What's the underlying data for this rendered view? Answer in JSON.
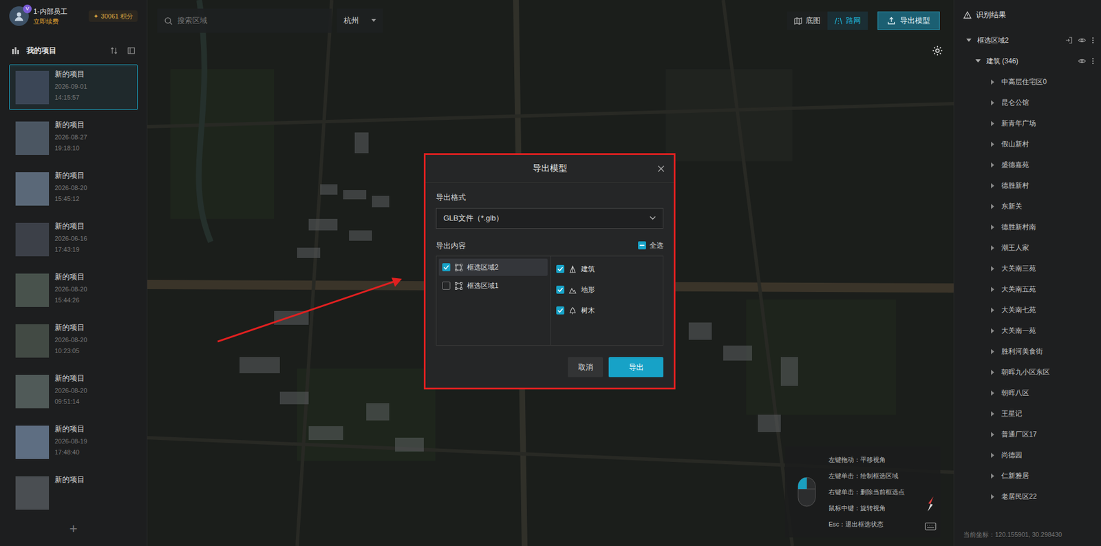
{
  "user": {
    "name": "1-内部员工",
    "badge": "V",
    "points_icon": "✦",
    "points": "30061 积分",
    "renew": "立即续费"
  },
  "projects": {
    "title": "我的项目",
    "add": "+",
    "items": [
      {
        "title": "新的项目",
        "date": "2026-09-01",
        "time": "14:15:57",
        "selected": true
      },
      {
        "title": "新的项目",
        "date": "2026-08-27",
        "time": "19:18:10",
        "selected": false
      },
      {
        "title": "新的项目",
        "date": "2026-08-20",
        "time": "15:45:12",
        "selected": false
      },
      {
        "title": "新的项目",
        "date": "2026-06-16",
        "time": "17:43:19",
        "selected": false
      },
      {
        "title": "新的项目",
        "date": "2026-08-20",
        "time": "15:44:26",
        "selected": false
      },
      {
        "title": "新的项目",
        "date": "2026-08-20",
        "time": "10:23:05",
        "selected": false
      },
      {
        "title": "新的项目",
        "date": "2026-08-20",
        "time": "09:51:14",
        "selected": false
      },
      {
        "title": "新的项目",
        "date": "2026-08-19",
        "time": "17:48:40",
        "selected": false
      },
      {
        "title": "新的项目",
        "selected": false
      }
    ]
  },
  "toolbar": {
    "search": {
      "placeholder": "搜索区域"
    },
    "city": "杭州",
    "view_tabs": [
      {
        "label": "底图",
        "selected": false
      },
      {
        "label": "路网",
        "selected": true
      }
    ],
    "export_button": "导出模型"
  },
  "dialog": {
    "title": "导出模型",
    "format_label": "导出格式",
    "format_value": "GLB文件（*.glb）",
    "content_label": "导出内容",
    "select_all": {
      "label": "全选",
      "checked": false,
      "indeterminate": true
    },
    "regions": [
      {
        "label": "框选区域2",
        "checked": true,
        "selected": true
      },
      {
        "label": "框选区域1",
        "checked": false,
        "selected": false
      }
    ],
    "layers": [
      {
        "label": "建筑",
        "checked": true
      },
      {
        "label": "地形",
        "checked": true
      },
      {
        "label": "树木",
        "checked": true
      }
    ],
    "buttons": [
      {
        "label": "取消",
        "primary": false
      },
      {
        "label": "导出",
        "primary": true
      }
    ]
  },
  "help": {
    "lines": [
      "左键拖动：平移视角",
      "左键单击：绘制框选区域",
      "右键单击：删除当前框选点",
      "鼠标中键：旋转视角",
      "Esc：退出框选状态"
    ]
  },
  "results": {
    "title": "识别结果",
    "region": {
      "label": "框选区域2",
      "expanded": true
    },
    "category": {
      "label": "建筑 (346)",
      "expanded": true
    },
    "items": [
      {
        "label": "中高层住宅区0",
        "expanded": false
      },
      {
        "label": "昆仑公馆",
        "expanded": false
      },
      {
        "label": "新青年广场",
        "expanded": false
      },
      {
        "label": "假山新村",
        "expanded": false
      },
      {
        "label": "盛德嘉苑",
        "expanded": false
      },
      {
        "label": "德胜新村",
        "expanded": false
      },
      {
        "label": "东新关",
        "expanded": false
      },
      {
        "label": "德胜新村南",
        "expanded": false
      },
      {
        "label": "潮王人家",
        "expanded": false
      },
      {
        "label": "大关南三苑",
        "expanded": false
      },
      {
        "label": "大关南五苑",
        "expanded": false
      },
      {
        "label": "大关南七苑",
        "expanded": false
      },
      {
        "label": "大关南一苑",
        "expanded": false
      },
      {
        "label": "胜利河美食街",
        "expanded": false
      },
      {
        "label": "朝晖九小区东区",
        "expanded": false
      },
      {
        "label": "朝晖八区",
        "expanded": false
      },
      {
        "label": "王星记",
        "expanded": false
      },
      {
        "label": "普通厂区17",
        "expanded": false
      },
      {
        "label": "尚德园",
        "expanded": false
      },
      {
        "label": "仁新雅居",
        "expanded": false
      },
      {
        "label": "老居民区22",
        "expanded": false
      }
    ],
    "coordinate": "当前坐标：120.155901, 30.298430"
  }
}
